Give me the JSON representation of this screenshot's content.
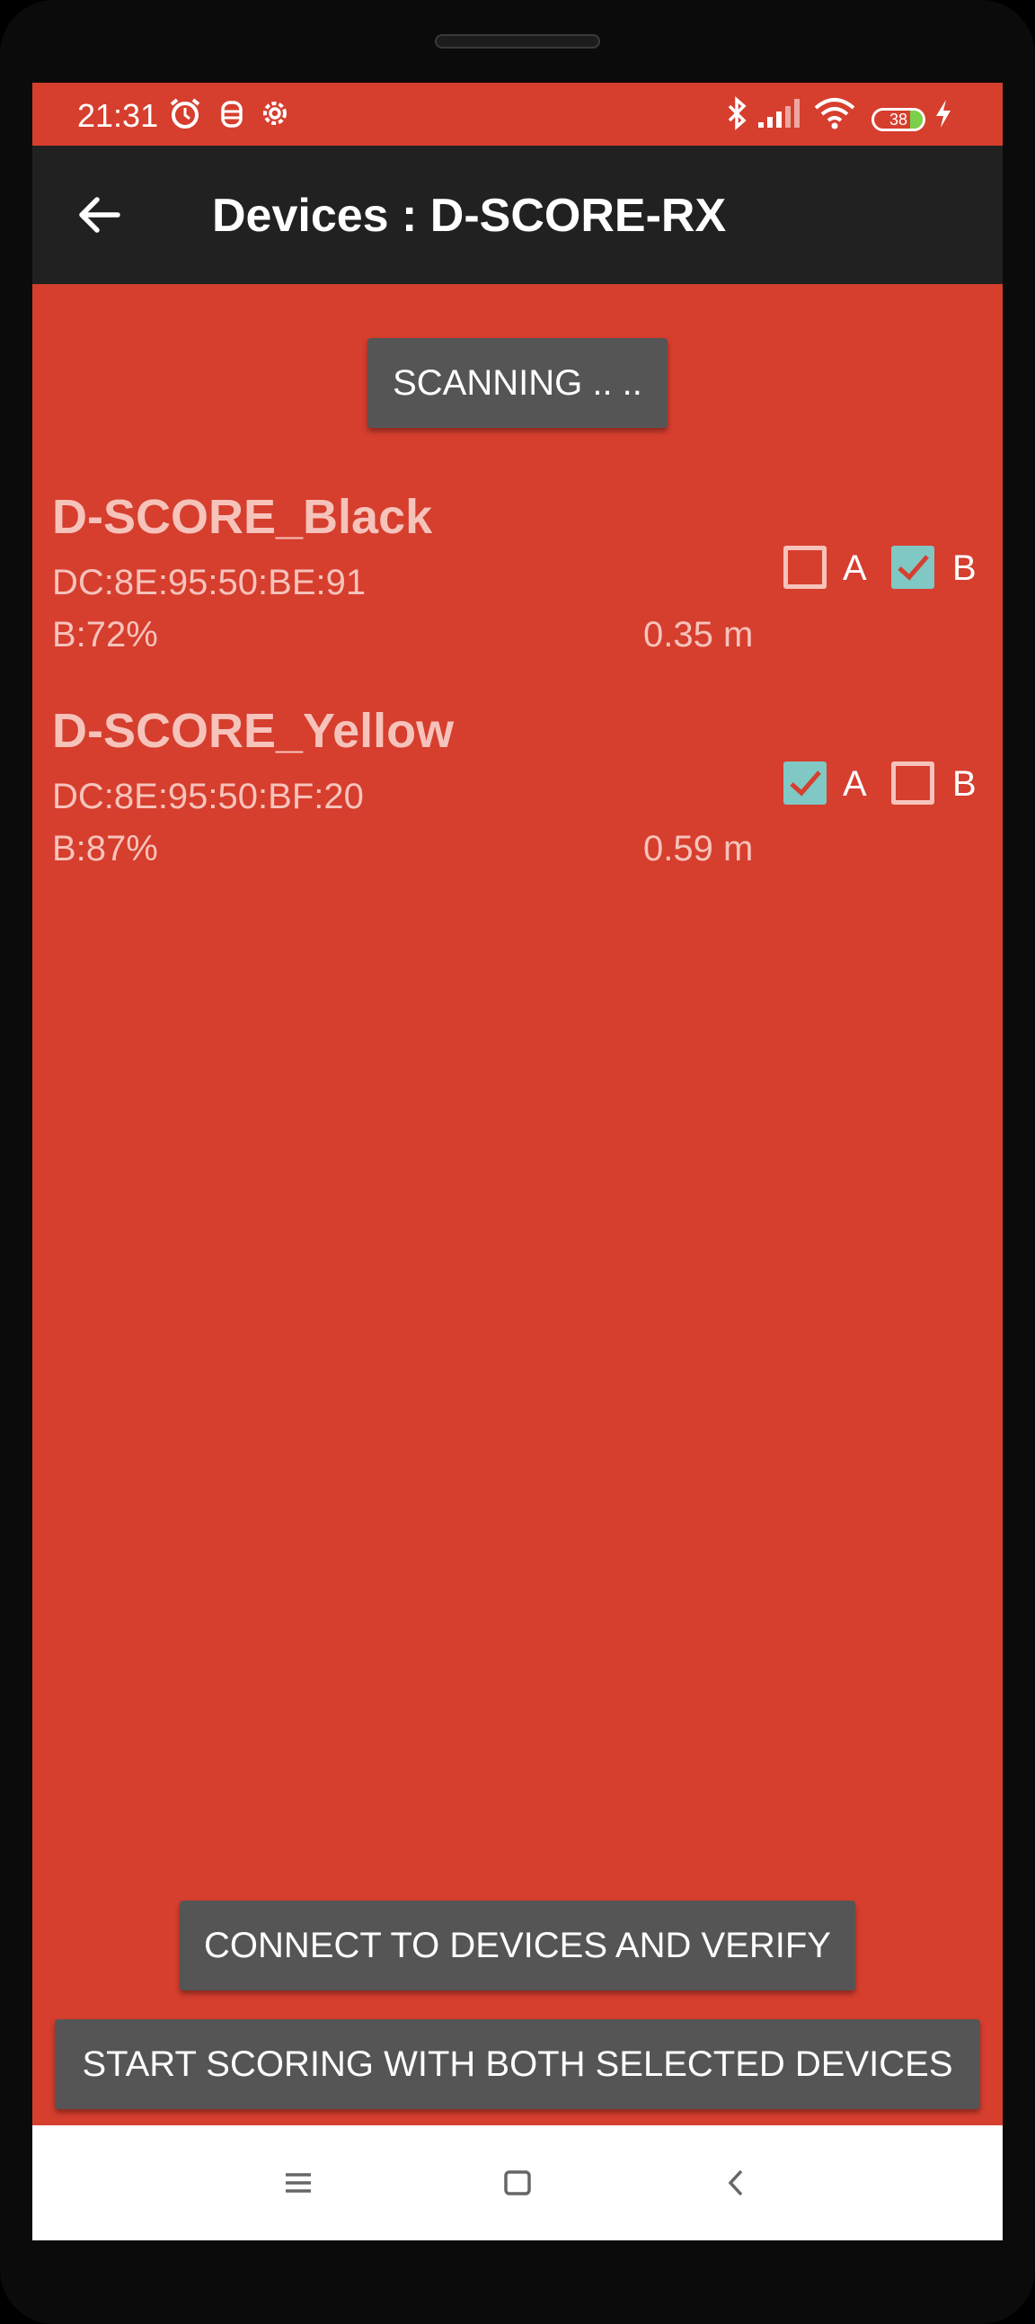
{
  "status_bar": {
    "time": "21:31",
    "battery_level": "38",
    "icons": [
      "alarm-icon",
      "notification-icon",
      "settings-icon",
      "bluetooth-icon",
      "signal-icon",
      "wifi-icon",
      "battery-icon",
      "charging-icon"
    ]
  },
  "app_bar": {
    "title": "Devices : D-SCORE-RX",
    "back_icon": "back-arrow-icon"
  },
  "scan_button": {
    "label": "SCANNING .. .."
  },
  "devices": [
    {
      "name": "D-SCORE_Black",
      "mac": "DC:8E:95:50:BE:91",
      "battery": "B:72%",
      "distance": "0.35 m",
      "checkbox_a": {
        "label": "A",
        "checked": false
      },
      "checkbox_b": {
        "label": "B",
        "checked": true
      }
    },
    {
      "name": "D-SCORE_Yellow",
      "mac": "DC:8E:95:50:BF:20",
      "battery": "B:87%",
      "distance": "0.59 m",
      "checkbox_a": {
        "label": "A",
        "checked": true
      },
      "checkbox_b": {
        "label": "B",
        "checked": false
      }
    }
  ],
  "connect_button": {
    "label": "CONNECT TO DEVICES AND VERIFY"
  },
  "start_button": {
    "label": "START SCORING WITH BOTH SELECTED DEVICES"
  },
  "nav_bar": {
    "icons": [
      "menu-icon",
      "home-icon",
      "back-icon"
    ]
  },
  "colors": {
    "background": "#d63e2e",
    "app_bar": "#212121",
    "button": "#555555",
    "checkbox_checked": "#7fc8c4",
    "device_text": "#f6c3bb"
  }
}
